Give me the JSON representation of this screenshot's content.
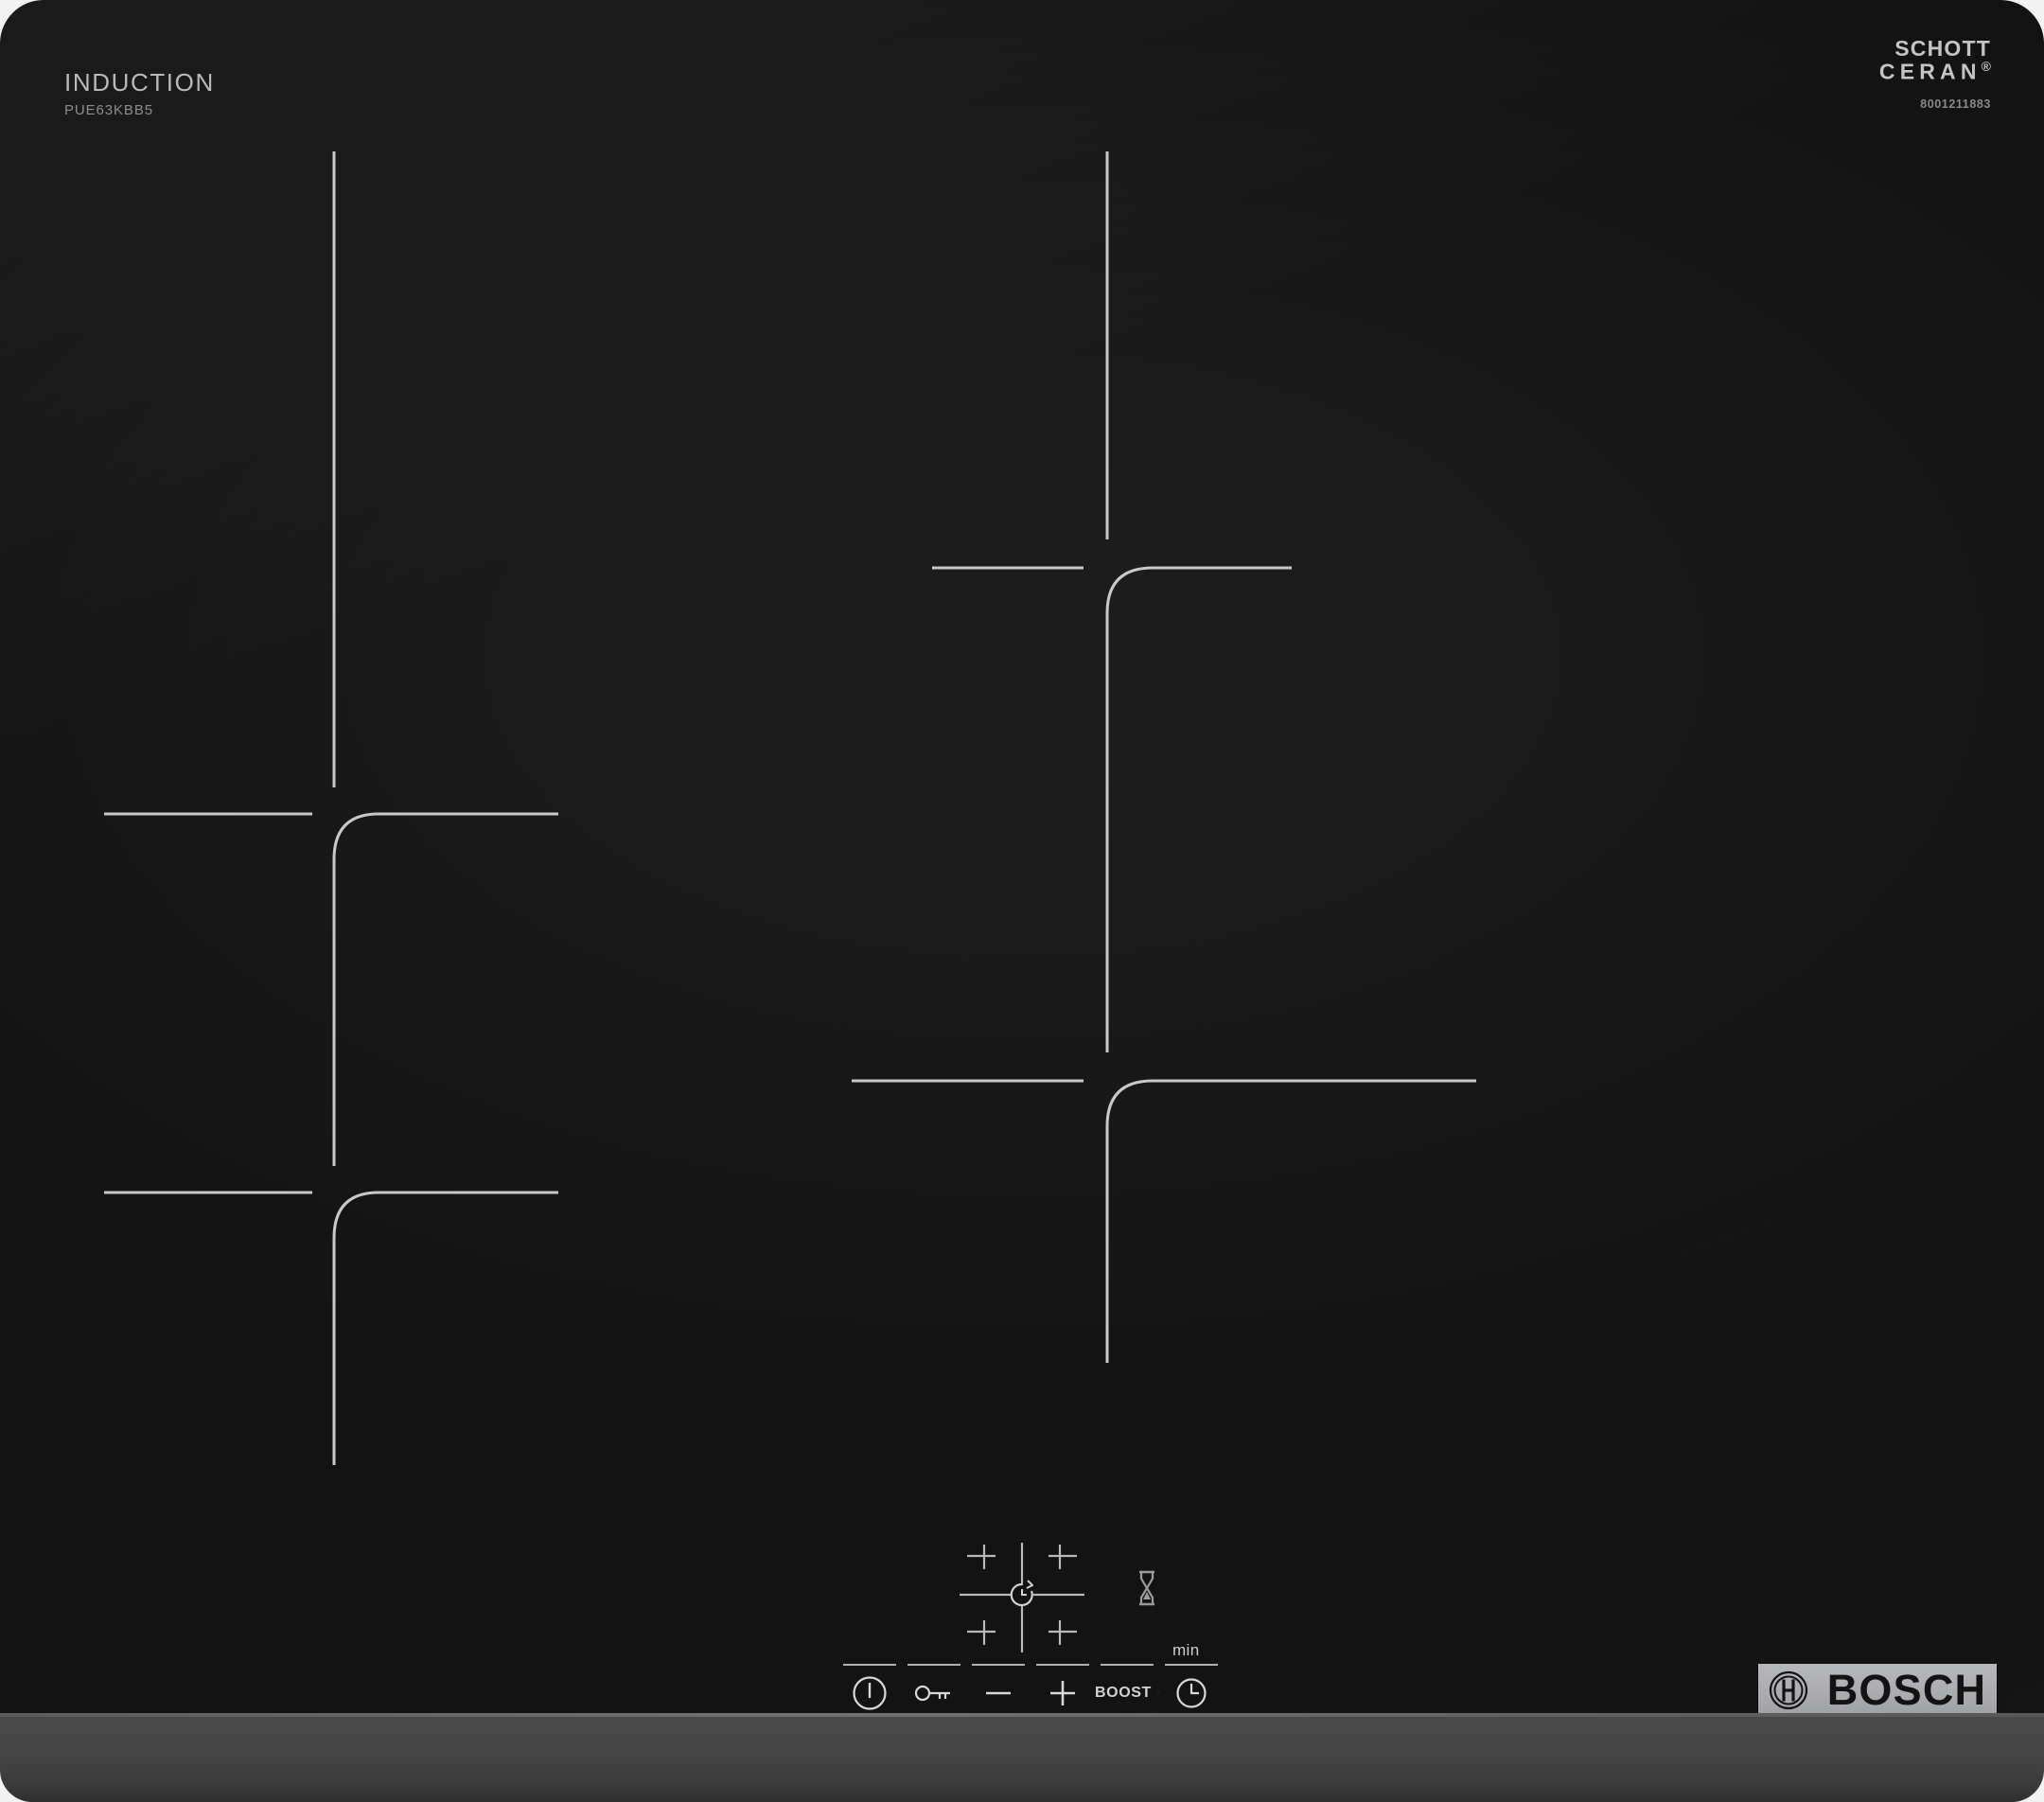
{
  "product": {
    "category_label": "INDUCTION",
    "model_number": "PUE63KBB5",
    "brand_name": "BOSCH",
    "brand_logo_icon": "bosch-armature-icon"
  },
  "glass_mark": {
    "line1": "SCHOTT",
    "line2": "CERAN",
    "registered_symbol": "®",
    "serial": "8001211883"
  },
  "colors": {
    "glass_black": "#171717",
    "marking_line": "#c9c9c9",
    "control_line": "#b2b2b2",
    "badge_gray": "#aaacb0",
    "frame_gray": "#454545",
    "label_gray": "#b9b9b9"
  },
  "cooking_zones": [
    {
      "name": "front-left-zone",
      "position": "top-left",
      "marking": "cross-with-rounded-corner"
    },
    {
      "name": "rear-right-zone",
      "position": "top-right",
      "marking": "cross-with-rounded-corner"
    },
    {
      "name": "rear-left-zone",
      "position": "bottom-left",
      "marking": "cross-with-rounded-corner"
    },
    {
      "name": "front-right-zone",
      "position": "bottom-right",
      "marking": "cross-with-rounded-corner"
    }
  ],
  "control_panel": {
    "zone_selector": {
      "name": "zone-selector-pad",
      "center_icon": "restart-clock-icon",
      "corner_marks": 4
    },
    "indicator": {
      "name": "hourglass-indicator",
      "icon": "hourglass-icon"
    },
    "timer_unit_label": "min",
    "buttons": [
      {
        "name": "power-button",
        "icon": "power-icon",
        "label": ""
      },
      {
        "name": "child-lock-button",
        "icon": "key-icon",
        "label": ""
      },
      {
        "name": "decrease-button",
        "icon": "minus-icon",
        "label": ""
      },
      {
        "name": "increase-button",
        "icon": "plus-icon",
        "label": ""
      },
      {
        "name": "boost-button",
        "icon": "chevron-up-icon",
        "label": "BOOST"
      },
      {
        "name": "timer-button",
        "icon": "clock-icon",
        "label": ""
      }
    ]
  }
}
